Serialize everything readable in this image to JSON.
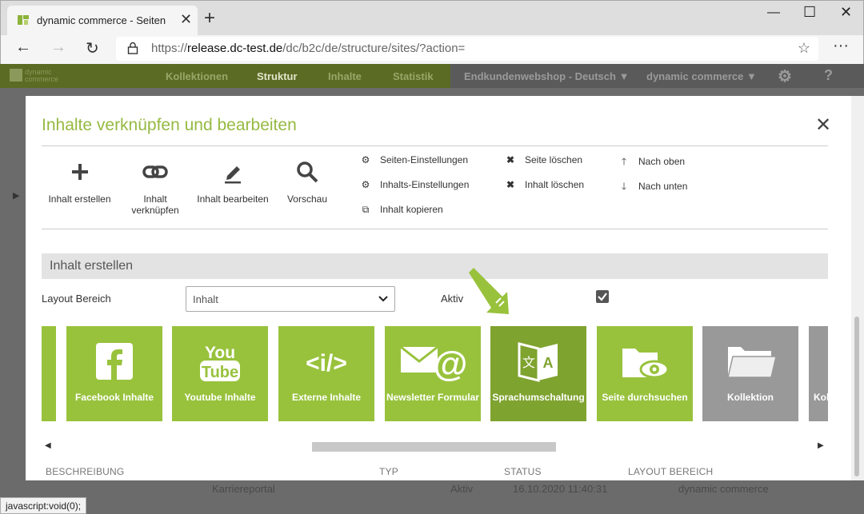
{
  "browser": {
    "tab_title": "dynamic commerce - Seiten",
    "url_prefix": "https://",
    "url_host": "release.dc-test.de",
    "url_path": "/dc/b2c/de/structure/sites/?action="
  },
  "app_header": {
    "logo_line1": "dynamic",
    "logo_line2": "commerce",
    "nav": [
      "Kollektionen",
      "Struktur",
      "Inhalte",
      "Statistik"
    ],
    "shop_select": "Endkundenwebshop - Deutsch",
    "company_select": "dynamic commerce",
    "help": "?"
  },
  "modal": {
    "title": "Inhalte verknüpfen und bearbeiten",
    "toolbar": {
      "create": "Inhalt erstellen",
      "link_line1": "Inhalt",
      "link_line2": "verknüpfen",
      "edit": "Inhalt bearbeiten",
      "preview": "Vorschau",
      "page_settings": "Seiten-Einstellungen",
      "content_settings": "Inhalts-Einstellungen",
      "copy_content": "Inhalt kopieren",
      "delete_page": "Seite löschen",
      "delete_content": "Inhalt löschen",
      "move_up": "Nach oben",
      "move_down": "Nach unten"
    },
    "section_title": "Inhalt erstellen",
    "layout_label": "Layout Bereich",
    "layout_value": "Inhalt",
    "active_label": "Aktiv",
    "active_checked": true,
    "tiles": [
      {
        "label": "Facebook Inhalte",
        "icon": "facebook-icon"
      },
      {
        "label": "Youtube Inhalte",
        "icon": "youtube-icon"
      },
      {
        "label": "Externe Inhalte",
        "icon": "code-icon"
      },
      {
        "label": "Newsletter Formular",
        "icon": "mail-at-icon"
      },
      {
        "label": "Sprachumschaltung",
        "icon": "translate-icon"
      },
      {
        "label": "Seite durchsuchen",
        "icon": "folder-eye-icon"
      },
      {
        "label": "Kollektion",
        "icon": "folder-icon"
      },
      {
        "label": "Kol",
        "icon": "folder-icon"
      }
    ],
    "table_headers": [
      "BESCHREIBUNG",
      "TYP",
      "STATUS",
      "LAYOUT BEREICH"
    ]
  },
  "background_row": {
    "name": "Karriereportal",
    "status": "Aktiv",
    "date": "16.10.2020 11:40:31",
    "layout": "dynamic commerce"
  },
  "status_bar": "javascript:void(0);",
  "colors": {
    "accent_green": "#98c23c",
    "title_green": "#96b942",
    "tile_gray": "#999999"
  }
}
